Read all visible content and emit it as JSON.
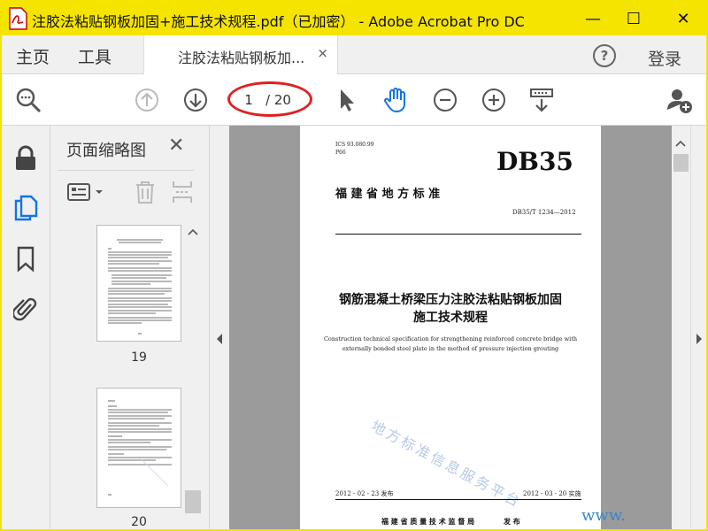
{
  "window": {
    "title": "注胶法粘贴钢板加固+施工技术规程.pdf（已加密） - Adobe Acrobat Pro DC",
    "minimize": "—",
    "maximize": "☐",
    "close": "✕"
  },
  "menubar": {
    "home": "主页",
    "tools": "工具",
    "doc_tab_label": "注胶法粘贴钢板加...",
    "doc_tab_close": "×",
    "help": "?",
    "login": "登录"
  },
  "toolbar": {
    "current_page": "1",
    "total_pages": "/ 20",
    "icons": [
      "search-zoom-icon",
      "page-up-icon",
      "page-down-icon",
      "select-cursor-icon",
      "hand-tool-icon",
      "zoom-out-icon",
      "zoom-in-icon",
      "scroll-mode-icon",
      "add-user-icon"
    ]
  },
  "sidebar": {
    "icons": [
      "lock-icon",
      "pages-icon",
      "bookmark-icon",
      "attachment-icon"
    ]
  },
  "thumbnails_panel": {
    "title": "页面缩略图",
    "close": "✕",
    "thumbnails": [
      {
        "label": "19"
      },
      {
        "label": "20"
      }
    ]
  },
  "document_page": {
    "ics": "ICS 93.080.99",
    "p66": "P66",
    "db": "DB35",
    "province": "福 建 省 地 方 标 准",
    "code": "DB35/T 1234—2012",
    "title_line1": "钢筋混凝土桥梁压力注胶法粘贴钢板加固",
    "title_line2": "施工技术规程",
    "en_line1": "Construction technical specification for strengthening reinforced concrete bridge with",
    "en_line2": "externally bonded steel plate in the method of pressure injection grouting",
    "watermark": "地方标准信息服务平台",
    "issue_date": "2012 - 02 - 23 发布",
    "impl_date": "2012 - 03 - 20 实施",
    "issuer": "福 建 省 质 量 技 术 监 督 局",
    "issuer_suffix": "发 布",
    "site_watermark": "www.          com"
  },
  "colors": {
    "titlebar": "#f5e400",
    "accent_red": "#e02020",
    "active_icon": "#1473e6"
  }
}
